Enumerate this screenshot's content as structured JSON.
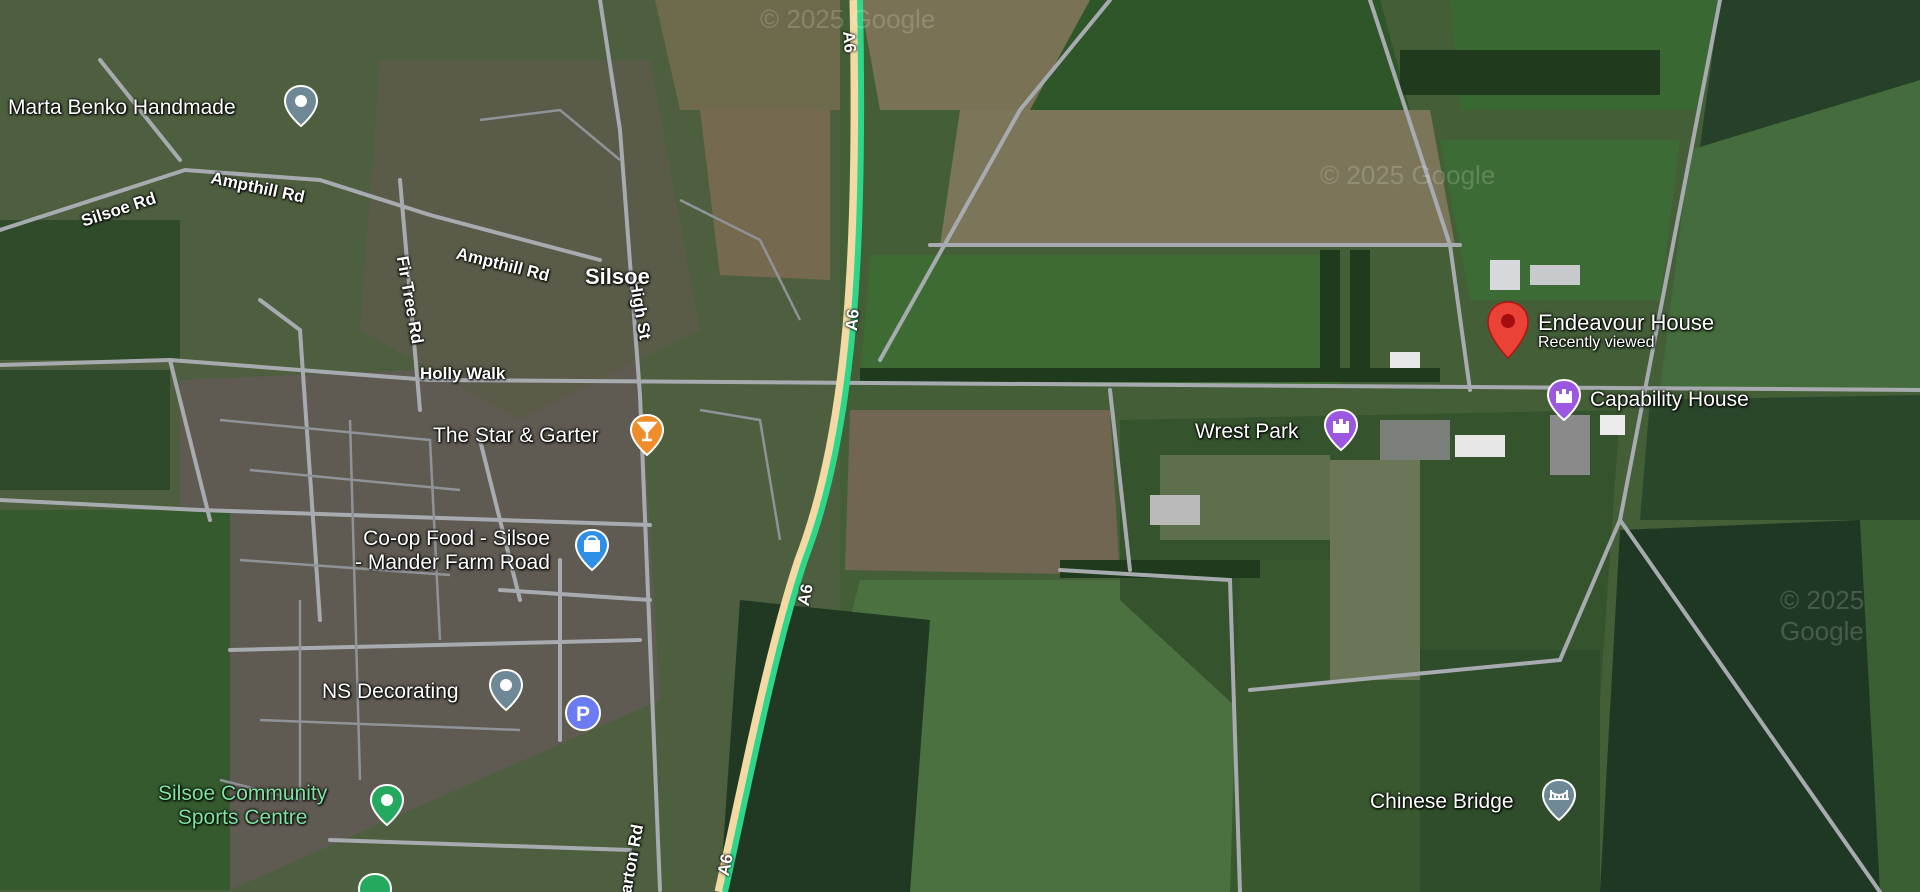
{
  "watermark": "© 2025 Google",
  "town_label": "Silsoe",
  "roads": {
    "silsoe_rd": "Silsoe Rd",
    "ampthill_rd_1": "Ampthill Rd",
    "ampthill_rd_2": "Ampthill Rd",
    "fir_tree_rd": "Fir Tree Rd",
    "holly_walk": "Holly Walk",
    "high_st": "High St",
    "barton_rd": "Barton Rd",
    "a6": "A6"
  },
  "places": {
    "marta_benko": "Marta Benko Handmade",
    "star_garter": "The Star & Garter",
    "coop_line1": "Co-op Food - Silsoe",
    "coop_line2": "- Mander Farm Road",
    "ns_decorating": "NS Decorating",
    "sports_line1": "Silsoe Community",
    "sports_line2": "Sports Centre",
    "endeavour": "Endeavour House",
    "endeavour_sub": "Recently viewed",
    "capability": "Capability House",
    "wrest_park": "Wrest Park",
    "chinese_bridge": "Chinese Bridge"
  },
  "parking_symbol": "P",
  "icons": {
    "poi_gray": "pin-icon",
    "bar": "cocktail-icon",
    "shop": "shopping-bag-icon",
    "castle": "castle-icon",
    "bridge": "bridge-icon",
    "sports": "pin-icon",
    "selected": "red-marker-icon",
    "parking": "parking-icon"
  },
  "colors": {
    "traffic_road": "#2ed68a",
    "bar_pin": "#f08c2a",
    "shop_pin": "#2f8fe8",
    "castle_pin": "#9b57e0",
    "gray_pin": "#6f8896",
    "green_pin": "#24a95e",
    "red_marker": "#ea4335"
  }
}
